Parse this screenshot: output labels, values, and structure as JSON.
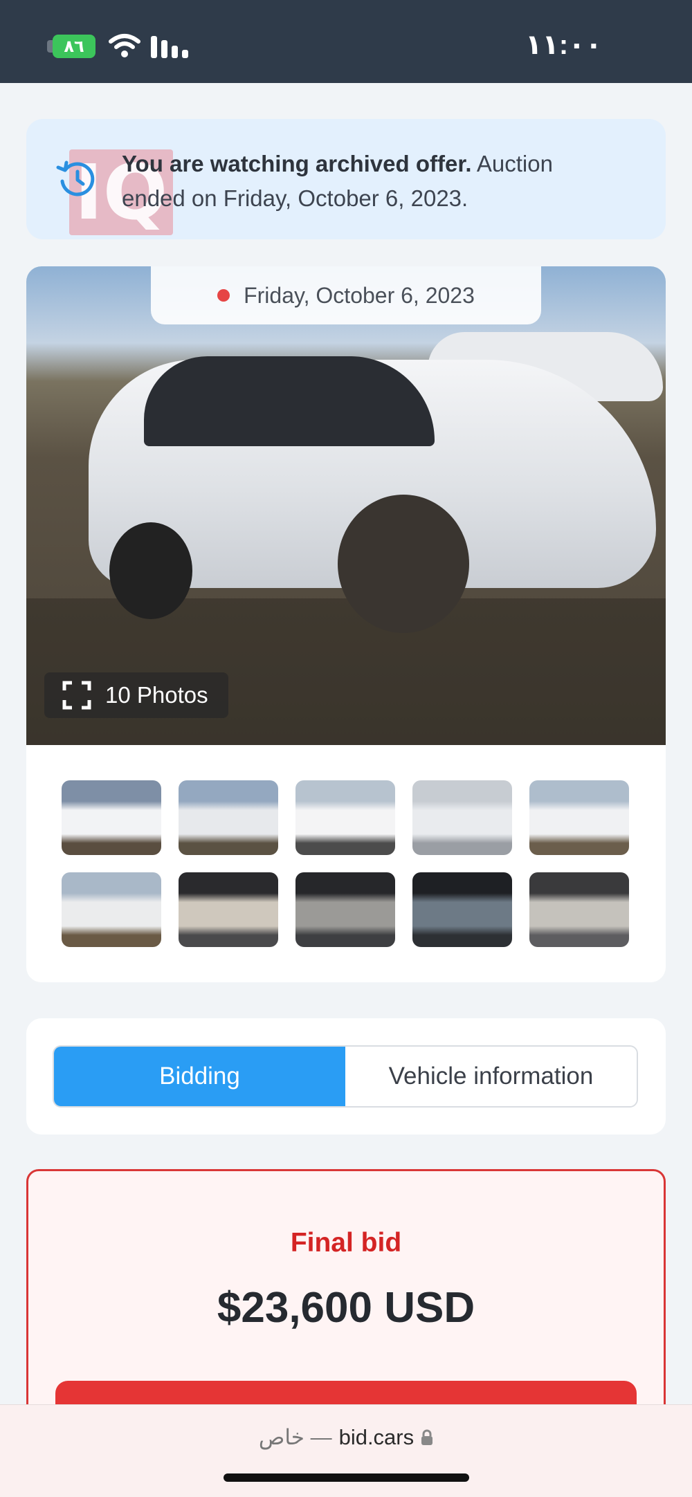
{
  "status_bar": {
    "battery": "٨٦",
    "clock": "١١:٠٠"
  },
  "banner": {
    "bold_text": "You are watching archived offer.",
    "text": "Auction ended on Friday, October 6, 2023.",
    "icon": "history-icon",
    "logo_text": "IQ"
  },
  "gallery": {
    "date": "Friday, October 6, 2023",
    "photos_label": "10 Photos",
    "thumbnails": [
      {
        "name": "thumb-front-left",
        "colors": [
          "#7e8fa6",
          "#f2f3f5",
          "#5a4e40"
        ]
      },
      {
        "name": "thumb-rear-left",
        "colors": [
          "#94a8c0",
          "#e7e9ec",
          "#5b5243"
        ]
      },
      {
        "name": "thumb-rear-right",
        "colors": [
          "#b7c3cf",
          "#f4f4f5",
          "#4c4c4c"
        ]
      },
      {
        "name": "thumb-front-right",
        "colors": [
          "#c7ccd2",
          "#e9ebee",
          "#9a9ea4"
        ]
      },
      {
        "name": "thumb-front",
        "colors": [
          "#aebdcc",
          "#f0f1f3",
          "#6b5e4c"
        ]
      },
      {
        "name": "thumb-rear",
        "colors": [
          "#a9b8c8",
          "#ebeced",
          "#6a5a45"
        ]
      },
      {
        "name": "thumb-interior-door",
        "colors": [
          "#2a2a2d",
          "#cfc8bd",
          "#4a4a4c"
        ]
      },
      {
        "name": "thumb-interior-console",
        "colors": [
          "#26272a",
          "#9b9a97",
          "#3e3f42"
        ]
      },
      {
        "name": "thumb-dashboard",
        "colors": [
          "#1e2024",
          "#6d7a86",
          "#2d3034"
        ]
      },
      {
        "name": "thumb-rear-seats",
        "colors": [
          "#3a3a3c",
          "#c5c2bc",
          "#5d5d60"
        ]
      }
    ]
  },
  "tabs": {
    "active": "Bidding",
    "inactive": "Vehicle information"
  },
  "bid": {
    "label": "Final bid",
    "amount": "$23,600 USD"
  },
  "browser": {
    "private": "خاص —",
    "domain": "bid.cars"
  },
  "colors": {
    "accent": "#2a9df4",
    "bid_red": "#d42424",
    "banner_bg": "#e3f0fd"
  }
}
